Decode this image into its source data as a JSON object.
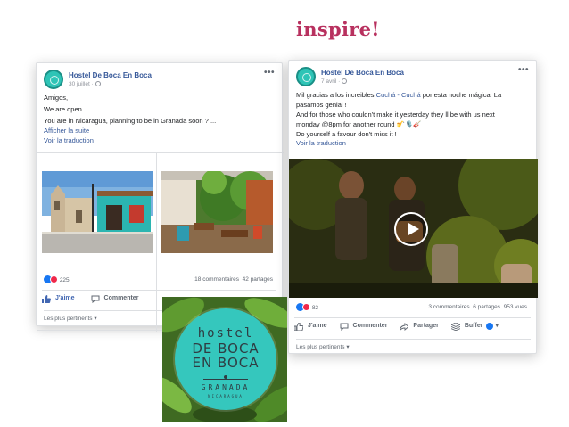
{
  "headline": "inspire!",
  "post_left": {
    "page_name": "Hostel De Boca En Boca",
    "date": "30 juillet ·",
    "lines": [
      "Amigos,",
      "We are open",
      "You are in Nicaragua, planning to be in Granada soon ? ..."
    ],
    "see_more": "Afficher la suite",
    "translate": "Voir la traduction",
    "reaction_count": "225",
    "comments": "18 commentaires",
    "shares": "42 partages",
    "like_label": "J'aime",
    "comment_label": "Commenter",
    "sort_label": "Les plus pertinents ▾"
  },
  "post_right": {
    "page_name": "Hostel De Boca En Boca",
    "date": "7 avril ·",
    "line1_a": "Mil gracias a los increibles ",
    "line1_link": "Cuchá - Cuchá",
    "line1_b": " por esta noche mágica. La",
    "line2": "pasamos genial !",
    "line3": "And for those who couldn't make it yesterday they ll be with us next",
    "line4": "monday @8pm for another round 🎷🎙️🎸",
    "line5": "Do yourself a favour don't miss it !",
    "translate": "Voir la traduction",
    "reaction_count": "82",
    "comments": "3 commentaires",
    "shares": "6 partages",
    "views": "953 vues",
    "like_label": "J'aime",
    "comment_label": "Commenter",
    "share_label": "Partager",
    "buffer_label": "Buffer",
    "sort_label": "Les plus pertinents ▾"
  },
  "logo": {
    "line1": "hostel",
    "line2": "DE BOCA",
    "line3": "EN BOCA",
    "line4": "GRANADA",
    "line5": "NICARAGUA"
  },
  "colors": {
    "headline": "#b8315f",
    "fb_blue": "#365899",
    "logo_teal": "#35c7bd"
  }
}
